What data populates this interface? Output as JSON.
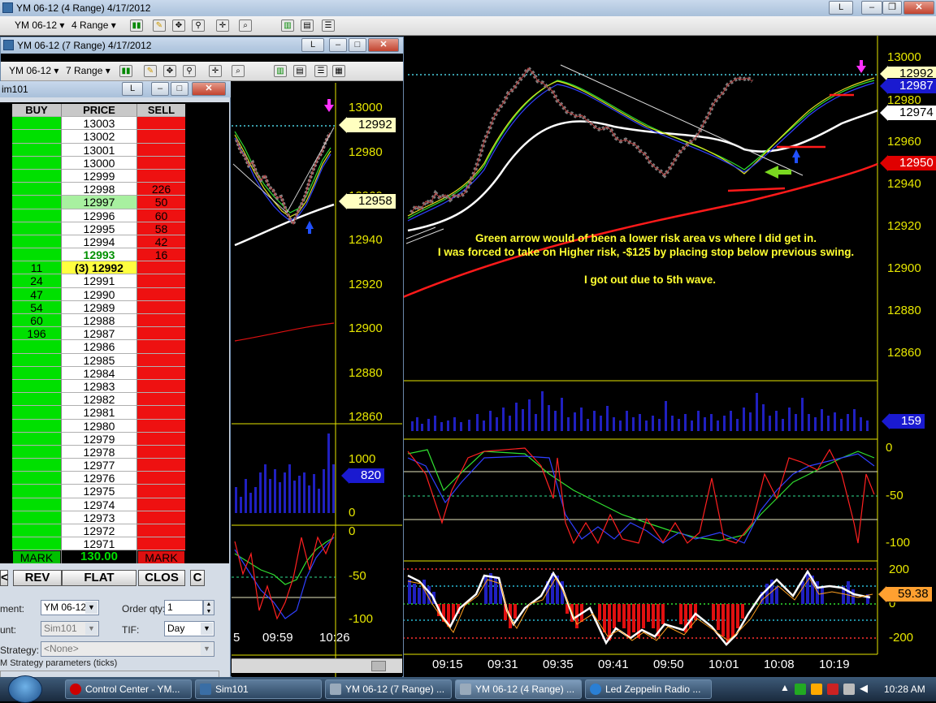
{
  "main_window": {
    "title": "YM 06-12 (4 Range)  4/17/2012",
    "toolbar": {
      "instrument": "YM 06-12",
      "period": "4 Range"
    },
    "buttons": {
      "link": "L"
    },
    "price_axis": [
      "13000",
      "12980",
      "12960",
      "12940",
      "12920",
      "12900",
      "12880",
      "12860"
    ],
    "price_tags": {
      "last": "12992",
      "blue": "12987",
      "white": "12974",
      "red": "12950"
    },
    "volume_tag": "159",
    "stoch_axis": [
      "0",
      "-50",
      "-100"
    ],
    "cci_axis": [
      "200",
      "0",
      "-200"
    ],
    "cci_tag": "59.38",
    "time_axis": [
      "09:15",
      "09:31",
      "09:35",
      "09:41",
      "09:50",
      "10:01",
      "10:08",
      "10:19"
    ],
    "annotation": {
      "line1": "Green arrow would of been a lower risk area vs where I did get in.",
      "line2": "I was forced to take on Higher risk, -$125 by placing stop below previous swing.",
      "line3": "I got out due to 5th wave."
    }
  },
  "mid_window": {
    "title": "YM 06-12 (7 Range)  4/17/2012",
    "toolbar": {
      "instrument": "YM 06-12",
      "period": "7 Range"
    },
    "buttons": {
      "link": "L"
    },
    "price_axis": [
      "13000",
      "12980",
      "12960",
      "12940",
      "12920",
      "12900",
      "12880",
      "12860"
    ],
    "price_tag": "12992",
    "price_tag2": "12958",
    "volume_axis": [
      "1000",
      "0"
    ],
    "volume_tag": "820",
    "stoch_axis": [
      "0",
      "-50",
      "-100"
    ],
    "time_axis": [
      "5",
      "09:59",
      "10:26"
    ]
  },
  "dom_window": {
    "title": "im101",
    "buttons": {
      "link": "L"
    },
    "headers": {
      "buy": "BUY",
      "price": "PRICE",
      "sell": "SELL"
    },
    "rows": [
      {
        "buy": "",
        "price": "13003",
        "sell": ""
      },
      {
        "buy": "",
        "price": "13002",
        "sell": ""
      },
      {
        "buy": "",
        "price": "13001",
        "sell": ""
      },
      {
        "buy": "",
        "price": "13000",
        "sell": ""
      },
      {
        "buy": "",
        "price": "12999",
        "sell": ""
      },
      {
        "buy": "",
        "price": "12998",
        "sell": "226"
      },
      {
        "buy": "",
        "price": "12997",
        "sell": "50"
      },
      {
        "buy": "",
        "price": "12996",
        "sell": "60"
      },
      {
        "buy": "",
        "price": "12995",
        "sell": "58"
      },
      {
        "buy": "",
        "price": "12994",
        "sell": "42"
      },
      {
        "buy": "",
        "price": "12993",
        "sell": "16"
      },
      {
        "buy": "11",
        "price": "(3) 12992",
        "sell": ""
      },
      {
        "buy": "24",
        "price": "12991",
        "sell": ""
      },
      {
        "buy": "47",
        "price": "12990",
        "sell": ""
      },
      {
        "buy": "54",
        "price": "12989",
        "sell": ""
      },
      {
        "buy": "60",
        "price": "12988",
        "sell": ""
      },
      {
        "buy": "196",
        "price": "12987",
        "sell": ""
      },
      {
        "buy": "",
        "price": "12986",
        "sell": ""
      },
      {
        "buy": "",
        "price": "12985",
        "sell": ""
      },
      {
        "buy": "",
        "price": "12984",
        "sell": ""
      },
      {
        "buy": "",
        "price": "12983",
        "sell": ""
      },
      {
        "buy": "",
        "price": "12982",
        "sell": ""
      },
      {
        "buy": "",
        "price": "12981",
        "sell": ""
      },
      {
        "buy": "",
        "price": "12980",
        "sell": ""
      },
      {
        "buy": "",
        "price": "12979",
        "sell": ""
      },
      {
        "buy": "",
        "price": "12978",
        "sell": ""
      },
      {
        "buy": "",
        "price": "12977",
        "sell": ""
      },
      {
        "buy": "",
        "price": "12976",
        "sell": ""
      },
      {
        "buy": "",
        "price": "12975",
        "sell": ""
      },
      {
        "buy": "",
        "price": "12974",
        "sell": ""
      },
      {
        "buy": "",
        "price": "12973",
        "sell": ""
      },
      {
        "buy": "",
        "price": "12972",
        "sell": ""
      },
      {
        "buy": "",
        "price": "12971",
        "sell": ""
      }
    ],
    "footer": {
      "buy": "MARK",
      "price": "130.00",
      "sell": "MARK"
    },
    "action_buttons": {
      "prev": "<",
      "rev": "REV",
      "flat": "FLAT",
      "close": "CLOS",
      "c": "C"
    },
    "form": {
      "instrument_label": "ment:",
      "instrument_value": "YM 06-12",
      "account_label": "unt:",
      "account_value": "Sim101",
      "order_qty_label": "Order qty:",
      "order_qty_value": "1",
      "tif_label": "TIF:",
      "tif_value": "Day",
      "strategy_label": "Strategy:",
      "strategy_value": "<None>",
      "strategy_params_label": "M Strategy parameters (ticks)"
    }
  },
  "taskbar": {
    "tasks": [
      "Control Center - YM...",
      "Sim101",
      "YM 06-12 (7 Range) ...",
      "YM 06-12 (4 Range) ...",
      "Led Zeppelin Radio ..."
    ],
    "clock": "10:28 AM"
  },
  "colors": {
    "axis": "#e6e600",
    "buy": "#00e000",
    "sell": "#ee1111",
    "ema": "#ff2020",
    "sma": "#ffffff",
    "volume": "#2020c0"
  }
}
